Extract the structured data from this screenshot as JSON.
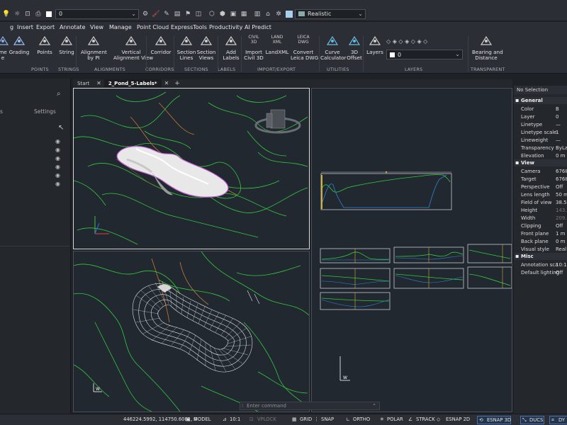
{
  "toolbar": {
    "layer_value": "0",
    "visual_style": "Realistic"
  },
  "menus": [
    "g",
    "Insert",
    "Export",
    "Annotate",
    "View",
    "Manage",
    "Point Cloud",
    "ExpressTools",
    "Productivity",
    "AI Predict"
  ],
  "ribbon": {
    "buttons": [
      {
        "label": "me\ne",
        "icon": "surface-icon"
      },
      {
        "label": "Grading",
        "icon": "grading-icon"
      },
      {
        "label": "Points",
        "icon": "points-icon"
      },
      {
        "label": "String",
        "icon": "string-icon"
      },
      {
        "label": "Alignment\nby PI",
        "icon": "alignment-pi-icon"
      },
      {
        "label": "Vertical\nAlignment View",
        "icon": "vertical-alignment-icon"
      },
      {
        "label": "Corridor",
        "icon": "corridor-icon"
      },
      {
        "label": "Section\nLines",
        "icon": "section-lines-icon"
      },
      {
        "label": "Section\nViews",
        "icon": "section-views-icon"
      },
      {
        "label": "Add\nLabels",
        "icon": "add-labels-icon"
      },
      {
        "label": "Import\nCivil 3D",
        "icon": "civil3d-icon",
        "top": "CIVIL\n3D"
      },
      {
        "label": "LandXML",
        "icon": "landxml-icon",
        "top": "LAND\nXML"
      },
      {
        "label": "Convert\nLeica DWG",
        "icon": "leica-icon",
        "top": "LEICA\nDWG"
      },
      {
        "label": "Curve\nCalculator",
        "icon": "curve-calculator-icon"
      },
      {
        "label": "3D\nOffset",
        "icon": "offset-3d-icon"
      },
      {
        "label": "Layers",
        "icon": "layers-icon"
      },
      {
        "label": "Bearing and\nDistance",
        "icon": "bearing-icon"
      }
    ],
    "groups": [
      "POINTS",
      "STRINGS",
      "ALIGNMENTS",
      "CORRIDORS",
      "SECTIONS",
      "LABELS",
      "IMPORT/EXPORT",
      "UTILITIES",
      "LAYERS",
      "TRANSPARENT"
    ],
    "layer_value": "0"
  },
  "left_panel": {
    "tab_left": "s",
    "tab_right": "Settings"
  },
  "tabs": [
    "Start",
    "2_Pond_5-Labels*"
  ],
  "command_placeholder": "Enter command",
  "properties": {
    "title": "No Selection",
    "sections": [
      {
        "name": "General",
        "rows": [
          {
            "k": "Color",
            "v": "B"
          },
          {
            "k": "Layer",
            "v": "0"
          },
          {
            "k": "Linetype",
            "v": "—"
          },
          {
            "k": "Linetype scale",
            "v": "1"
          },
          {
            "k": "Lineweight",
            "v": "—"
          },
          {
            "k": "Transparency",
            "v": "ByLa"
          },
          {
            "k": "Elevation",
            "v": "0 m"
          }
        ]
      },
      {
        "name": "View",
        "rows": [
          {
            "k": "Camera",
            "v": "6768"
          },
          {
            "k": "Target",
            "v": "6768"
          },
          {
            "k": "Perspective",
            "v": "Off"
          },
          {
            "k": "Lens length",
            "v": "50 m"
          },
          {
            "k": "Field of view",
            "v": "38.5"
          },
          {
            "k": "Height",
            "v": "143.",
            "dim": true
          },
          {
            "k": "Width",
            "v": "209.",
            "dim": true
          },
          {
            "k": "Clipping",
            "v": "Off"
          },
          {
            "k": "Front plane",
            "v": "1 m"
          },
          {
            "k": "Back plane",
            "v": "0 m"
          },
          {
            "k": "Visual style",
            "v": "Real"
          }
        ]
      },
      {
        "name": "Misc",
        "rows": [
          {
            "k": "Annotation sca",
            "v": "10:1"
          },
          {
            "k": "Default lighting",
            "v": "Off"
          }
        ]
      }
    ]
  },
  "statusbar": {
    "coords": "446224.5992, 114750.6081, 0",
    "model": "MODEL",
    "scale": "10:1",
    "vplock": "VPLOCK",
    "grid": "GRID",
    "snap": "SNAP",
    "ortho": "ORTHO",
    "polar": "POLAR",
    "strack": "STRACK",
    "esnap2d": "ESNAP 2D",
    "esnap3d": "ESNAP 3D",
    "ducs": "DUCS",
    "dyn": "DY"
  },
  "colors": {
    "accent": "#4a9fe0",
    "contour": "#34c93e",
    "bg": "#212830"
  }
}
